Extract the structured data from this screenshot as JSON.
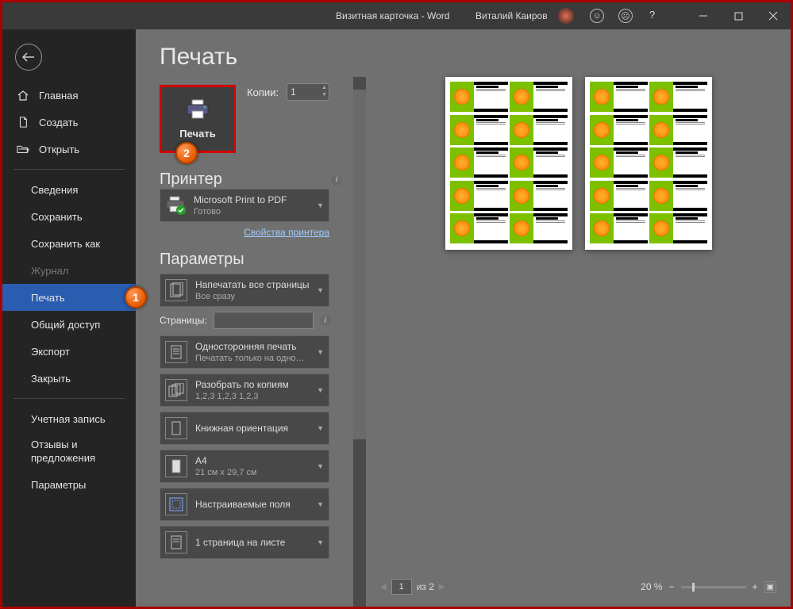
{
  "title_app": "Визитная карточка  -  Word",
  "user": "Виталий Каиров",
  "sidebar": {
    "home": "Главная",
    "new": "Создать",
    "open": "Открыть",
    "info": "Сведения",
    "save": "Сохранить",
    "saveas": "Сохранить как",
    "history": "Журнал",
    "print": "Печать",
    "share": "Общий доступ",
    "export": "Экспорт",
    "close": "Закрыть",
    "account": "Учетная запись",
    "feedback": "Отзывы и предложения",
    "options": "Параметры"
  },
  "badge1": "1",
  "badge2": "2",
  "page_title": "Печать",
  "print_label": "Печать",
  "copies_label": "Копии:",
  "copies_value": "1",
  "printer_h": "Принтер",
  "printer_name": "Microsoft Print to PDF",
  "printer_status": "Готово",
  "printer_props": "Свойства принтера",
  "params_h": "Параметры",
  "dd_pages": {
    "t": "Напечатать все страницы",
    "s": "Все сразу"
  },
  "pages_label": "Страницы:",
  "dd_sides": {
    "t": "Односторонняя печать",
    "s": "Печатать только на одно…"
  },
  "dd_collate": {
    "t": "Разобрать по копиям",
    "s": "1,2,3    1,2,3    1,2,3"
  },
  "dd_orient": {
    "t": "Книжная ориентация"
  },
  "dd_size": {
    "t": "A4",
    "s": "21 см x 29,7 см"
  },
  "dd_margin": {
    "t": "Настраиваемые поля"
  },
  "dd_sheet": {
    "t": "1 страница на листе"
  },
  "pv_current": "1",
  "pv_total": "из 2",
  "zoom": "20 %"
}
